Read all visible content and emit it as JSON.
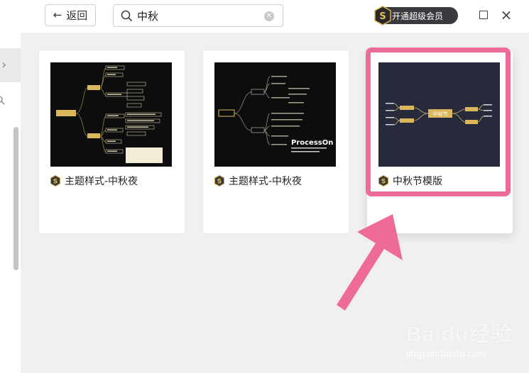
{
  "toolbar": {
    "back_label": "返回",
    "search_value": "中秋",
    "vip_label": "开通超级会员"
  },
  "templates": [
    {
      "title": "主题样式-中秋夜",
      "theme": "dark"
    },
    {
      "title": "主题样式-中秋夜",
      "theme": "dark",
      "thumb_brand": "ProcessOn"
    },
    {
      "title": "中秋节模版",
      "theme": "navy",
      "thumb_center": "中秋节"
    }
  ],
  "watermark": {
    "brand": "Baidu经验",
    "sub": "jingyan.baidu.com"
  },
  "colors": {
    "accent_pink": "#ee6a98",
    "thumb_node_gold": "#d9b75a"
  },
  "icons": [
    "arrow-left-icon",
    "search-icon",
    "clear-icon",
    "vip-badge-icon",
    "maximize-icon",
    "close-icon",
    "chevron-right-icon",
    "hex-badge-icon"
  ]
}
